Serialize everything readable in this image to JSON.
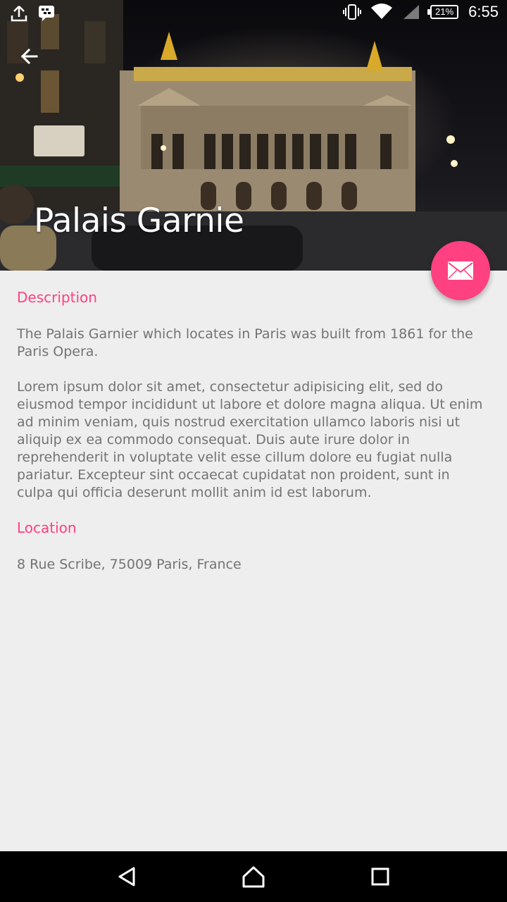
{
  "status_bar": {
    "battery": "21%",
    "time": "6:55",
    "icons": [
      "upload-icon",
      "bbm-icon",
      "vibrate-icon",
      "wifi-icon",
      "signal-icon",
      "battery-icon"
    ]
  },
  "header": {
    "title": "Palais Garnie",
    "back_icon": "arrow-left-icon"
  },
  "fab": {
    "icon": "mail-icon",
    "color": "#ff4081"
  },
  "description": {
    "heading": "Description",
    "paragraphs": [
      "The Palais Garnier which locates in Paris was built from 1861 for the Paris Opera.",
      "Lorem ipsum dolor sit amet, consectetur adipisicing elit, sed do eiusmod tempor incididunt ut labore et dolore magna aliqua. Ut enim ad minim veniam, quis nostrud exercitation ullamco laboris nisi ut aliquip ex ea commodo consequat. Duis aute irure dolor in reprehenderit in voluptate velit esse cillum dolore eu fugiat nulla pariatur. Excepteur sint occaecat cupidatat non proident, sunt in culpa qui officia deserunt mollit anim id est laborum."
    ]
  },
  "location": {
    "heading": "Location",
    "address": "8 Rue Scribe, 75009 Paris, France"
  },
  "nav_bar": {
    "icons": [
      "back-triangle-icon",
      "home-icon",
      "recents-square-icon"
    ]
  },
  "colors": {
    "accent": "#ff4081",
    "background": "#eeeeee",
    "body_text": "#737373"
  }
}
